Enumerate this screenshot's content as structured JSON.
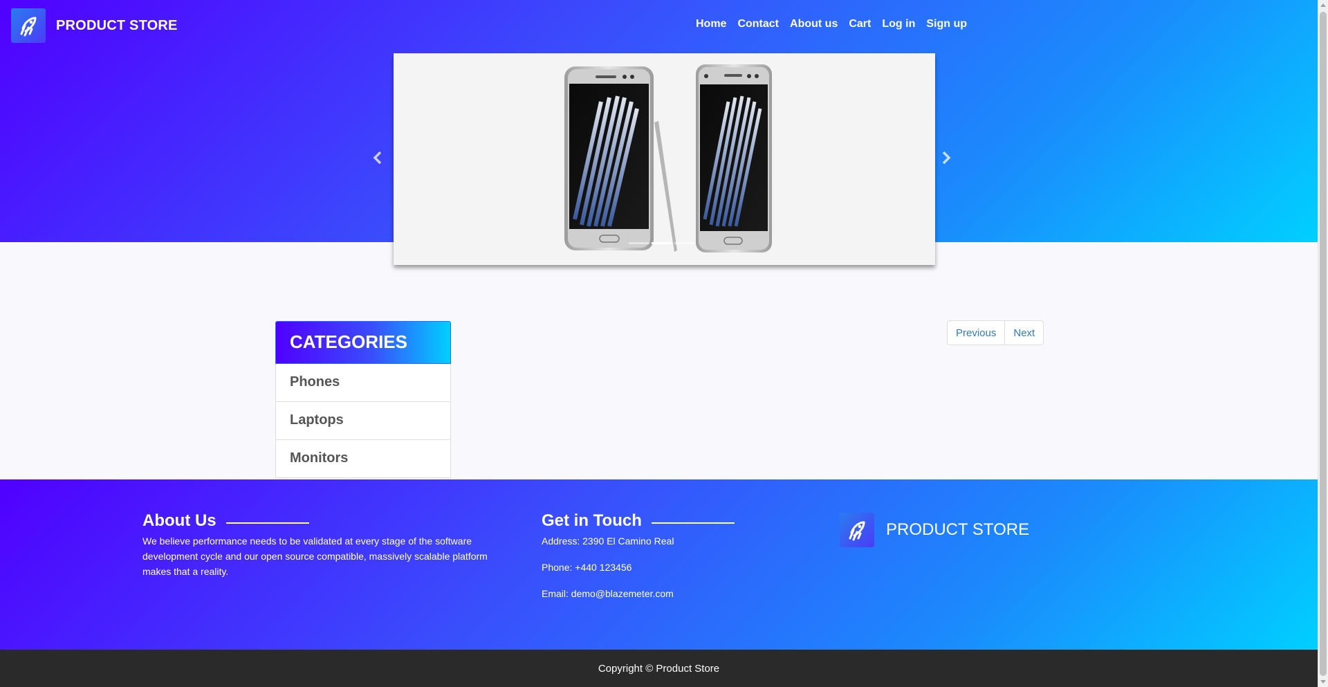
{
  "header": {
    "brand": "PRODUCT STORE",
    "logo_icon": "rocket-icon",
    "nav": [
      {
        "label": "Home"
      },
      {
        "label": "Contact"
      },
      {
        "label": "About us"
      },
      {
        "label": "Cart"
      },
      {
        "label": "Log in"
      },
      {
        "label": "Sign up"
      }
    ]
  },
  "carousel": {
    "slide_alt": "Samsung Galaxy phones with stylus",
    "prev_icon": "chevron-left-icon",
    "next_icon": "chevron-right-icon",
    "indicator_count": 3,
    "active_indicator": 1
  },
  "categories": {
    "title": "CATEGORIES",
    "items": [
      {
        "label": "Phones"
      },
      {
        "label": "Laptops"
      },
      {
        "label": "Monitors"
      }
    ]
  },
  "pagination": {
    "previous": "Previous",
    "next": "Next"
  },
  "footer": {
    "about_title": "About Us",
    "about_text": "We believe performance needs to be validated at every stage of the software development cycle and our open source compatible, massively scalable platform makes that a reality.",
    "contact_title": "Get in Touch",
    "address": "Address: 2390 El Camino Real",
    "phone": "Phone: +440 123456",
    "email": "Email: demo@blazemeter.com",
    "brand": "PRODUCT STORE",
    "copyright": "Copyright © Product Store"
  },
  "colors": {
    "gradient_start": "#5000ff",
    "gradient_end": "#00d0ff",
    "link": "#337ab7",
    "copyright_bg": "#2a2a2a"
  }
}
